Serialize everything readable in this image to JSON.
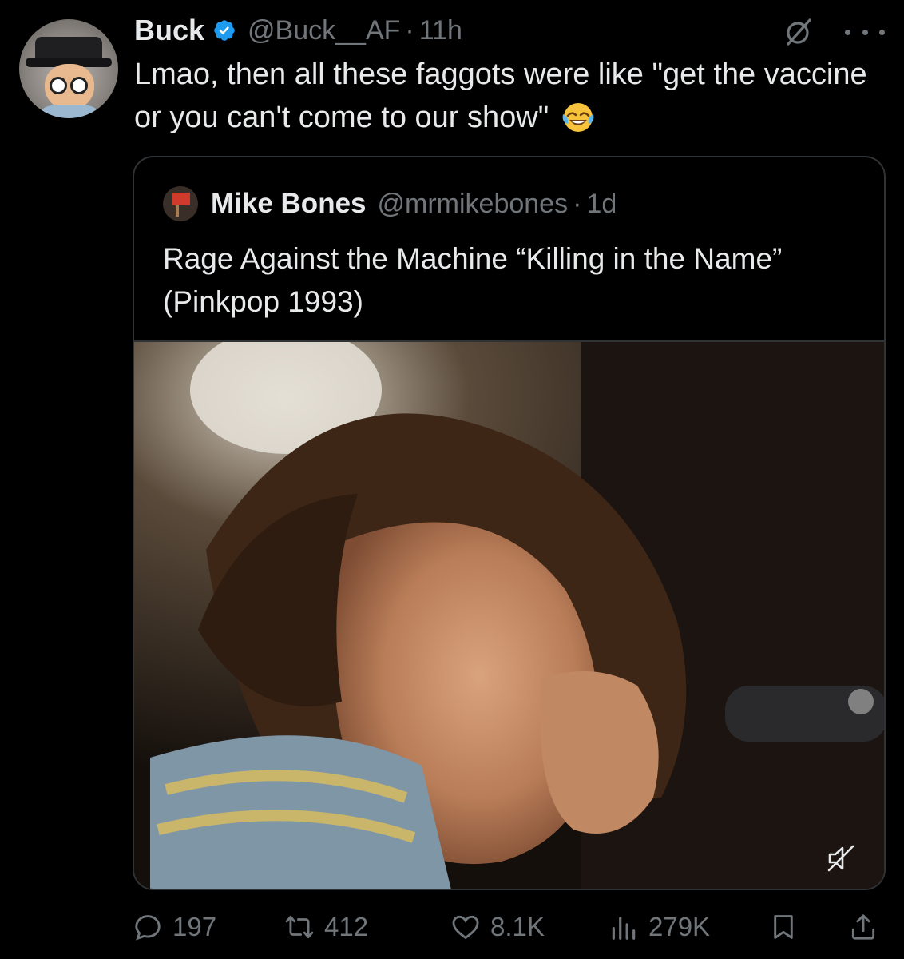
{
  "tweet": {
    "author": {
      "name": "Buck",
      "handle": "@Buck__AF",
      "time": "11h",
      "separator": "·"
    },
    "text": "Lmao, then all these faggots were like \"get the vaccine or you can't come to our show\"",
    "emoji": "face-with-tears-of-joy"
  },
  "quote": {
    "author": {
      "name": "Mike Bones",
      "handle": "@mrmikebones",
      "time": "1d",
      "separator": "·"
    },
    "text": "Rage Against the Machine “Killing in the Name” (Pinkpop 1993)",
    "media": {
      "type": "video",
      "muted": true
    }
  },
  "actions": {
    "replies": "197",
    "retweets": "412",
    "likes": "8.1K",
    "views": "279K"
  },
  "colors": {
    "background": "#000000",
    "text": "#e7e9ea",
    "secondary": "#71767b",
    "border": "#2f3336",
    "verified": "#1d9bf0"
  }
}
